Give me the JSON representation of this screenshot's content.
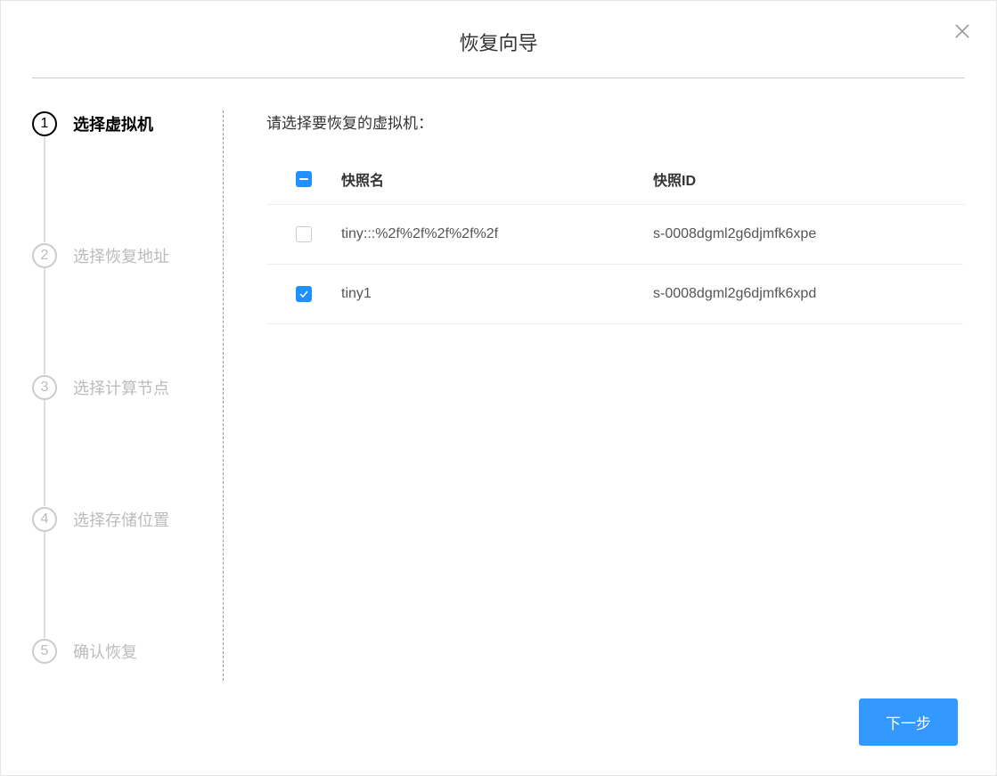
{
  "modal": {
    "title": "恢复向导"
  },
  "steps": [
    {
      "number": "1",
      "label": "选择虚拟机",
      "active": true
    },
    {
      "number": "2",
      "label": "选择恢复地址",
      "active": false
    },
    {
      "number": "3",
      "label": "选择计算节点",
      "active": false
    },
    {
      "number": "4",
      "label": "选择存储位置",
      "active": false
    },
    {
      "number": "5",
      "label": "确认恢复",
      "active": false
    }
  ],
  "content": {
    "prompt": "请选择要恢复的虚拟机："
  },
  "table": {
    "headers": {
      "name": "快照名",
      "id": "快照ID"
    },
    "select_all_state": "indeterminate",
    "rows": [
      {
        "checked": false,
        "name": "tiny:::%2f%2f%2f%2f%2f",
        "id": "s-0008dgml2g6djmfk6xpe"
      },
      {
        "checked": true,
        "name": "tiny1",
        "id": "s-0008dgml2g6djmfk6xpd"
      }
    ]
  },
  "footer": {
    "next_label": "下一步"
  }
}
